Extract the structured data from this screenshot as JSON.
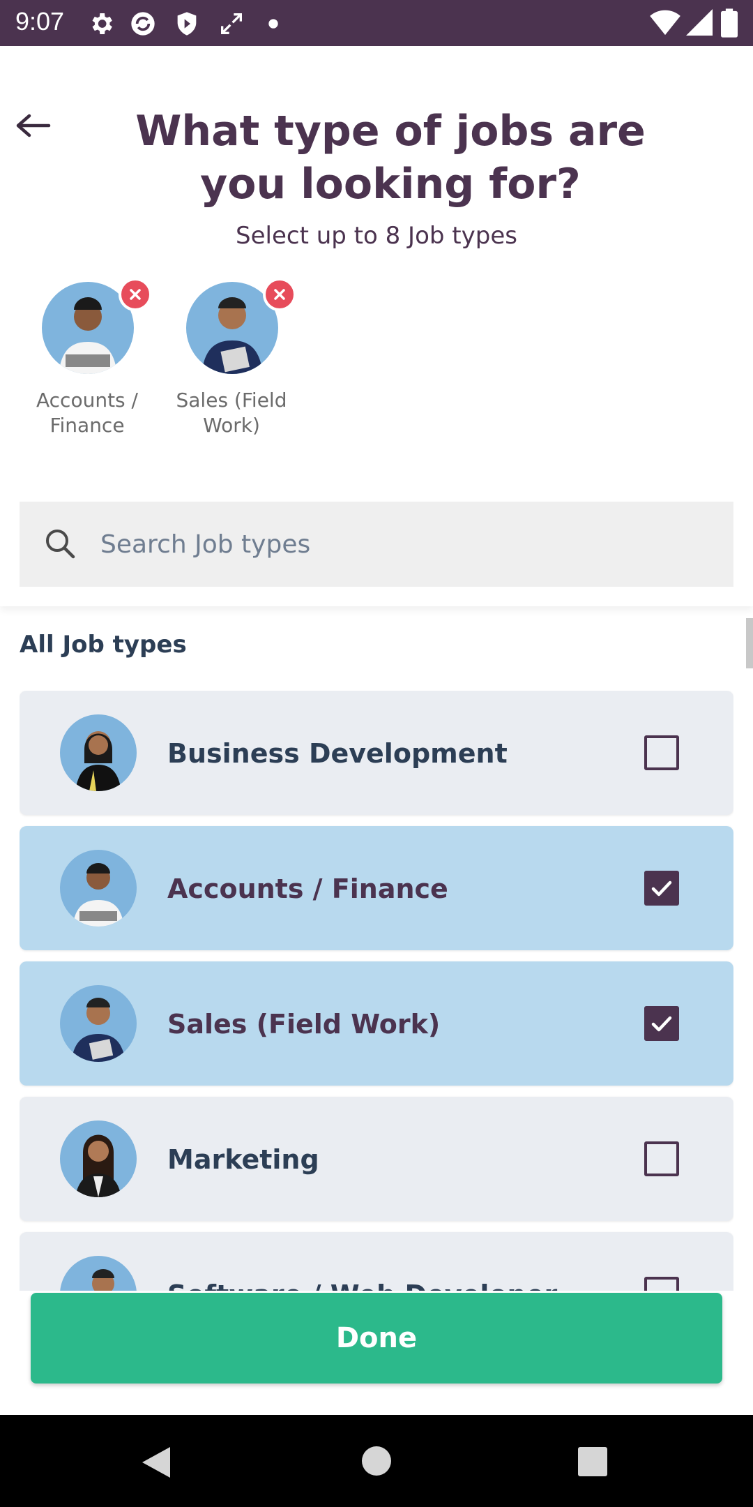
{
  "status_bar": {
    "time": "9:07",
    "icons": [
      "settings-icon",
      "sync-icon",
      "shield-icon",
      "expand-icon",
      "dot-icon",
      "wifi-icon",
      "signal-icon",
      "battery-icon"
    ]
  },
  "header": {
    "back_icon": "arrow-left-icon",
    "title": "What type of jobs are you looking for?",
    "subtitle": "Select up to 8 Job types"
  },
  "selected": [
    {
      "label": "Accounts / Finance"
    },
    {
      "label": "Sales (Field Work)"
    }
  ],
  "search": {
    "placeholder": "Search Job types",
    "value": ""
  },
  "section_title": "All Job types",
  "jobs": [
    {
      "name": "Business Development",
      "checked": false
    },
    {
      "name": "Accounts / Finance",
      "checked": true
    },
    {
      "name": "Sales (Field Work)",
      "checked": true
    },
    {
      "name": "Marketing",
      "checked": false
    },
    {
      "name": "Software / Web Developer",
      "checked": false
    }
  ],
  "done_label": "Done",
  "colors": {
    "primary": "#4b334f",
    "accent": "#2cb98b",
    "selected_bg": "#b8d9ee",
    "remove": "#e74c5b"
  }
}
